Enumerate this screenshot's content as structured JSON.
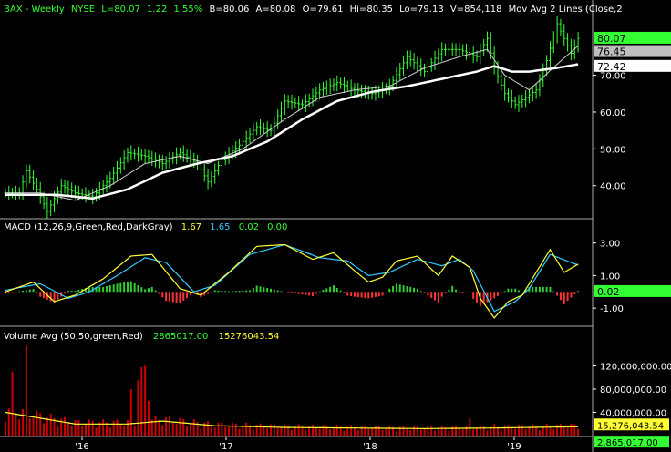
{
  "chart_data": [
    {
      "type": "candlestick",
      "panel": "price",
      "header": {
        "symbol": "BAX",
        "period": "Weekly",
        "exchange": "NYSE",
        "last": "L=80.07",
        "change": "1.22",
        "change_pct": "1.55%",
        "bid": "B=80.06",
        "ask": "A=80.08",
        "open": "O=79.61",
        "high": "Hi=80.35",
        "low": "Lo=79.13",
        "volume": "V=854,118",
        "study": "Mov Avg 2 Lines (Close,2"
      },
      "ylim": [
        32,
        86
      ],
      "yticks": [
        40,
        50,
        60,
        70
      ],
      "ytick_labels": [
        "40.00",
        "50.00",
        "60.00",
        "70.00"
      ],
      "x_labels": [
        "'16",
        "'17",
        "'18",
        "'19"
      ],
      "anchors": [
        [
          0,
          38
        ],
        [
          4,
          38
        ],
        [
          6,
          44
        ],
        [
          9,
          39
        ],
        [
          12,
          33
        ],
        [
          16,
          40
        ],
        [
          20,
          38
        ],
        [
          25,
          37
        ],
        [
          30,
          42
        ],
        [
          35,
          49
        ],
        [
          40,
          48
        ],
        [
          45,
          46
        ],
        [
          50,
          49
        ],
        [
          55,
          46
        ],
        [
          58,
          41
        ],
        [
          62,
          47
        ],
        [
          67,
          51
        ],
        [
          72,
          56
        ],
        [
          76,
          55
        ],
        [
          80,
          63
        ],
        [
          85,
          62
        ],
        [
          90,
          66
        ],
        [
          95,
          68
        ],
        [
          100,
          66
        ],
        [
          105,
          65
        ],
        [
          110,
          67
        ],
        [
          115,
          75
        ],
        [
          120,
          71
        ],
        [
          125,
          77
        ],
        [
          130,
          77
        ],
        [
          135,
          75
        ],
        [
          138,
          80
        ],
        [
          140,
          72
        ],
        [
          143,
          65
        ],
        [
          146,
          62
        ],
        [
          149,
          64
        ],
        [
          152,
          66
        ],
        [
          155,
          74
        ],
        [
          158,
          84
        ],
        [
          160,
          80
        ],
        [
          162,
          76
        ],
        [
          164,
          80
        ]
      ],
      "sma_slow_anchors": [
        [
          0,
          37.5
        ],
        [
          15,
          37.5
        ],
        [
          25,
          36.5
        ],
        [
          35,
          39
        ],
        [
          45,
          43.5
        ],
        [
          55,
          46
        ],
        [
          65,
          48
        ],
        [
          75,
          52
        ],
        [
          85,
          58
        ],
        [
          95,
          63
        ],
        [
          105,
          65.5
        ],
        [
          115,
          67
        ],
        [
          125,
          69
        ],
        [
          135,
          71
        ],
        [
          140,
          72.5
        ],
        [
          145,
          71
        ],
        [
          150,
          71
        ],
        [
          158,
          72
        ],
        [
          164,
          73
        ]
      ],
      "sma_fast_anchors": [
        [
          0,
          38
        ],
        [
          10,
          38
        ],
        [
          20,
          36
        ],
        [
          30,
          40
        ],
        [
          40,
          46
        ],
        [
          50,
          48
        ],
        [
          58,
          46
        ],
        [
          68,
          50
        ],
        [
          80,
          58
        ],
        [
          90,
          64
        ],
        [
          100,
          66
        ],
        [
          110,
          67
        ],
        [
          120,
          72
        ],
        [
          130,
          75
        ],
        [
          138,
          77
        ],
        [
          143,
          70
        ],
        [
          150,
          66
        ],
        [
          158,
          73
        ],
        [
          164,
          78
        ]
      ],
      "price_labels": [
        {
          "text": "80.07",
          "value": 80.07,
          "bg": "#33ff33",
          "color": "#000000"
        },
        {
          "text": "76.45",
          "value": 76.45,
          "bg": "#bfbfbf",
          "color": "#000000"
        },
        {
          "text": "72.42",
          "value": 72.42,
          "bg": "#ffffff",
          "color": "#000000"
        }
      ]
    },
    {
      "type": "macd",
      "panel": "macd",
      "title": "MACD (12,26,9,Green,Red,DarkGray)",
      "values": [
        "1.67",
        "1.65",
        "0.02",
        "0.00"
      ],
      "value_colors": [
        "#ffff33",
        "#33ccff",
        "#33ff33",
        "#33ff33"
      ],
      "ylim": [
        -2.0,
        3.6
      ],
      "yticks": [
        3.0,
        1.0,
        -1.0
      ],
      "ytick_labels": [
        "3.00",
        "1.00",
        "-1.00"
      ],
      "macd_anchors": [
        [
          0,
          0
        ],
        [
          8,
          0.6
        ],
        [
          14,
          -0.6
        ],
        [
          20,
          -0.2
        ],
        [
          28,
          0.8
        ],
        [
          36,
          2.2
        ],
        [
          42,
          2.3
        ],
        [
          50,
          0.2
        ],
        [
          56,
          -0.2
        ],
        [
          64,
          1.2
        ],
        [
          72,
          2.8
        ],
        [
          80,
          2.9
        ],
        [
          88,
          2.0
        ],
        [
          94,
          2.4
        ],
        [
          100,
          1.3
        ],
        [
          104,
          0.6
        ],
        [
          108,
          0.9
        ],
        [
          112,
          1.9
        ],
        [
          118,
          2.2
        ],
        [
          124,
          1.0
        ],
        [
          128,
          2.2
        ],
        [
          133,
          1.5
        ],
        [
          136,
          -0.4
        ],
        [
          140,
          -1.6
        ],
        [
          144,
          -0.6
        ],
        [
          148,
          -0.2
        ],
        [
          152,
          1.2
        ],
        [
          156,
          2.6
        ],
        [
          160,
          1.2
        ],
        [
          164,
          1.7
        ]
      ],
      "signal_anchors": [
        [
          0,
          0.1
        ],
        [
          10,
          0.5
        ],
        [
          18,
          -0.4
        ],
        [
          24,
          0
        ],
        [
          32,
          1
        ],
        [
          40,
          2.1
        ],
        [
          46,
          1.8
        ],
        [
          54,
          0
        ],
        [
          60,
          0.4
        ],
        [
          70,
          2.3
        ],
        [
          80,
          2.9
        ],
        [
          90,
          2.1
        ],
        [
          98,
          1.9
        ],
        [
          104,
          1.0
        ],
        [
          110,
          1.2
        ],
        [
          118,
          2.0
        ],
        [
          125,
          1.6
        ],
        [
          130,
          2.0
        ],
        [
          134,
          1.3
        ],
        [
          140,
          -1.2
        ],
        [
          146,
          -0.6
        ],
        [
          150,
          0.2
        ],
        [
          156,
          2.3
        ],
        [
          162,
          1.8
        ],
        [
          164,
          1.65
        ]
      ],
      "label": {
        "text": "0.02",
        "value": 0.02,
        "bg": "#33ff33",
        "color": "#000000"
      }
    },
    {
      "type": "bar",
      "panel": "volume",
      "title": "Volume Avg (50,50,green,Red)",
      "values": [
        "2865017.00",
        "15276043.54"
      ],
      "value_colors": [
        "#33ff33",
        "#ffff33"
      ],
      "ylim": [
        0,
        160000000
      ],
      "yticks": [
        120000000,
        80000000,
        40000000
      ],
      "ytick_labels": [
        "120,000,000.00",
        "80,000,000.00",
        "40,000,000.00"
      ],
      "spikes": [
        [
          2,
          110000000
        ],
        [
          6,
          155000000
        ],
        [
          36,
          80000000
        ],
        [
          38,
          95000000
        ],
        [
          39,
          118000000
        ],
        [
          40,
          120000000
        ],
        [
          41,
          60000000
        ],
        [
          133,
          30000000
        ],
        [
          140,
          20000000
        ]
      ],
      "avg_anchors": [
        [
          0,
          40000000
        ],
        [
          10,
          30000000
        ],
        [
          20,
          20000000
        ],
        [
          35,
          20000000
        ],
        [
          45,
          25000000
        ],
        [
          60,
          17000000
        ],
        [
          80,
          14000000
        ],
        [
          120,
          12000000
        ],
        [
          140,
          13000000
        ],
        [
          164,
          15276043
        ]
      ],
      "labels": [
        {
          "text": "15,276,043.54",
          "value": 15276043.54,
          "bg": "#ffff33",
          "color": "#000000"
        },
        {
          "text": "2,865,017.00",
          "value": 2865017,
          "bg": "#33ff33",
          "color": "#000000"
        }
      ]
    }
  ],
  "colors": {
    "background": "#000000",
    "candle_up": "#33ff33",
    "sma_slow": "#ffffff",
    "sma_fast": "#d0d0d0",
    "macd": "#ffff33",
    "signal": "#33ccff",
    "hist_pos": "#33cc33",
    "hist_neg": "#ff3333",
    "volume": "#cc0000",
    "volume_avg": "#ffff33",
    "grid": "#ffffff"
  }
}
